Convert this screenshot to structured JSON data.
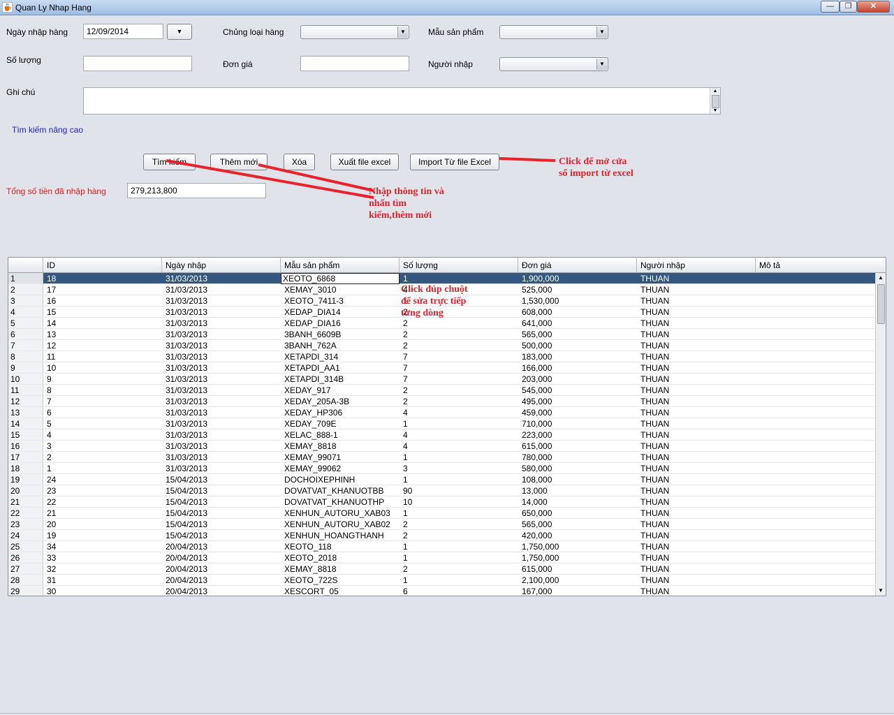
{
  "window": {
    "title": "Quan Ly Nhap Hang",
    "min_glyph": "—",
    "max_glyph": "❐",
    "close_glyph": "✕",
    "icon": "java-cup-icon"
  },
  "form": {
    "import_date_label": "Ngày nhập hàng",
    "import_date_value": "12/09/2014",
    "date_picker_glyph": "▼",
    "category_label": "Chủng loại hàng",
    "category_value": "",
    "product_model_label": "Mẫu sản phẩm",
    "product_model_value": "",
    "quantity_label": "Số lượng",
    "quantity_value": "",
    "unit_price_label": "Đơn giá",
    "unit_price_value": "",
    "importer_label": "Người nhập",
    "importer_value": "",
    "notes_label": "Ghi chú",
    "notes_value": "",
    "advanced_search_link": "Tìm kiếm nâng cao",
    "combo_arrow_glyph": "▼",
    "scroll_up_glyph": "▲",
    "scroll_down_glyph": "▼"
  },
  "buttons": {
    "search": "Tìm kiếm",
    "add_new": "Thêm mới",
    "delete": "Xóa",
    "export_excel": "Xuất file excel",
    "import_excel": "Import Từ file Excel"
  },
  "total": {
    "label": "Tổng số tiền đã nhập hàng",
    "value": "279,213,800"
  },
  "annotations": {
    "import_note_line1": "Click để mở cửa",
    "import_note_line2": "sổ import từ excel",
    "search_note_line1": "Nhập thông tin và",
    "search_note_line2": "nhấn tìm",
    "search_note_line3": "kiếm,thêm mới",
    "edit_note_line1": "Click đúp chuột",
    "edit_note_line2": "để sửa trực tiếp",
    "edit_note_line3": "từng dòng",
    "color": "#e8232b"
  },
  "table": {
    "columns": [
      "",
      "ID",
      "Ngày nhập",
      "Mẫu sản phẩm",
      "Số lượng",
      "Đơn giá",
      "Người nhập",
      "Mô tả"
    ],
    "selected_row": 1,
    "rows": [
      [
        "1",
        "18",
        "31/03/2013",
        "XEOTO_6868",
        "1",
        "1,900,000",
        "THUAN",
        ""
      ],
      [
        "2",
        "17",
        "31/03/2013",
        "XEMAY_3010",
        "4",
        "525,000",
        "THUAN",
        ""
      ],
      [
        "3",
        "16",
        "31/03/2013",
        "XEOTO_7411-3",
        "1",
        "1,530,000",
        "THUAN",
        ""
      ],
      [
        "4",
        "15",
        "31/03/2013",
        "XEDAP_DIA14",
        "2",
        "608,000",
        "THUAN",
        ""
      ],
      [
        "5",
        "14",
        "31/03/2013",
        "XEDAP_DIA16",
        "2",
        "641,000",
        "THUAN",
        ""
      ],
      [
        "6",
        "13",
        "31/03/2013",
        "3BANH_6609B",
        "2",
        "565,000",
        "THUAN",
        ""
      ],
      [
        "7",
        "12",
        "31/03/2013",
        "3BANH_762A",
        "2",
        "500,000",
        "THUAN",
        ""
      ],
      [
        "8",
        "11",
        "31/03/2013",
        "XETAPDI_314",
        "7",
        "183,000",
        "THUAN",
        ""
      ],
      [
        "9",
        "10",
        "31/03/2013",
        "XETAPDI_AA1",
        "7",
        "166,000",
        "THUAN",
        ""
      ],
      [
        "10",
        "9",
        "31/03/2013",
        "XETAPDI_314B",
        "7",
        "203,000",
        "THUAN",
        ""
      ],
      [
        "11",
        "8",
        "31/03/2013",
        "XEDAY_917",
        "2",
        "545,000",
        "THUAN",
        ""
      ],
      [
        "12",
        "7",
        "31/03/2013",
        "XEDAY_205A-3B",
        "2",
        "495,000",
        "THUAN",
        ""
      ],
      [
        "13",
        "6",
        "31/03/2013",
        "XEDAY_HP306",
        "4",
        "459,000",
        "THUAN",
        ""
      ],
      [
        "14",
        "5",
        "31/03/2013",
        "XEDAY_709E",
        "1",
        "710,000",
        "THUAN",
        ""
      ],
      [
        "15",
        "4",
        "31/03/2013",
        "XELAC_888-1",
        "4",
        "223,000",
        "THUAN",
        ""
      ],
      [
        "16",
        "3",
        "31/03/2013",
        "XEMAY_8818",
        "4",
        "615,000",
        "THUAN",
        ""
      ],
      [
        "17",
        "2",
        "31/03/2013",
        "XEMAY_99071",
        "1",
        "780,000",
        "THUAN",
        ""
      ],
      [
        "18",
        "1",
        "31/03/2013",
        "XEMAY_99062",
        "3",
        "580,000",
        "THUAN",
        ""
      ],
      [
        "19",
        "24",
        "15/04/2013",
        "DOCHOIXEPHINH",
        "1",
        "108,000",
        "THUAN",
        ""
      ],
      [
        "20",
        "23",
        "15/04/2013",
        "DOVATVAT_KHANUOTBB",
        "90",
        "13,000",
        "THUAN",
        ""
      ],
      [
        "21",
        "22",
        "15/04/2013",
        "DOVATVAT_KHANUOTHP",
        "10",
        "14,000",
        "THUAN",
        ""
      ],
      [
        "22",
        "21",
        "15/04/2013",
        "XENHUN_AUTORU_XAB03",
        "1",
        "650,000",
        "THUAN",
        ""
      ],
      [
        "23",
        "20",
        "15/04/2013",
        "XENHUN_AUTORU_XAB02",
        "2",
        "565,000",
        "THUAN",
        ""
      ],
      [
        "24",
        "19",
        "15/04/2013",
        "XENHUN_HOANGTHANH",
        "2",
        "420,000",
        "THUAN",
        ""
      ],
      [
        "25",
        "34",
        "20/04/2013",
        "XEOTO_118",
        "1",
        "1,750,000",
        "THUAN",
        ""
      ],
      [
        "26",
        "33",
        "20/04/2013",
        "XEOTO_2018",
        "1",
        "1,750,000",
        "THUAN",
        ""
      ],
      [
        "27",
        "32",
        "20/04/2013",
        "XEMAY_8818",
        "2",
        "615,000",
        "THUAN",
        ""
      ],
      [
        "28",
        "31",
        "20/04/2013",
        "XEOTO_722S",
        "1",
        "2,100,000",
        "THUAN",
        ""
      ],
      [
        "29",
        "30",
        "20/04/2013",
        "XESCORT_05",
        "6",
        "167,000",
        "THUAN",
        ""
      ]
    ]
  }
}
